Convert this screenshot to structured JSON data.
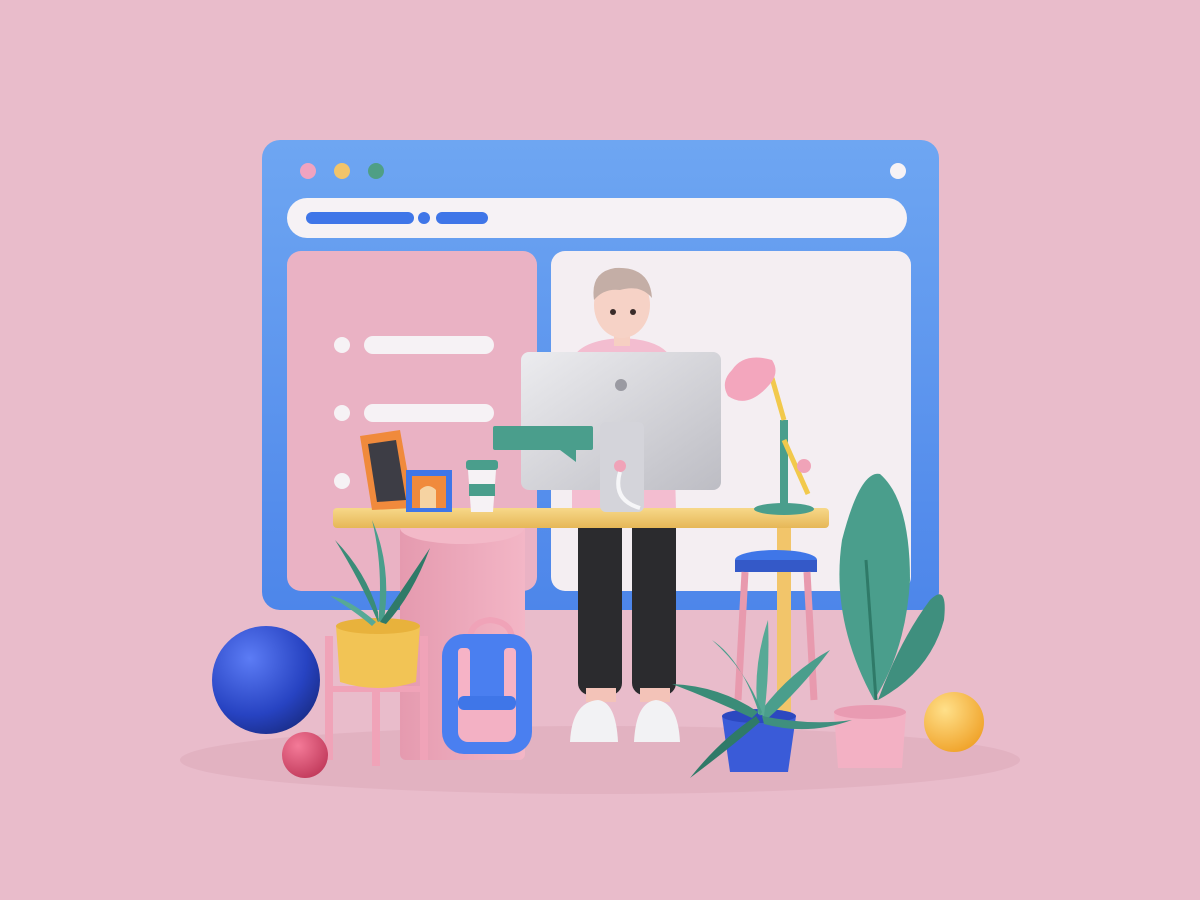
{
  "scene": {
    "description_free": true,
    "colors": {
      "background": "#e9bccb",
      "window_frame": "#5b9df0",
      "window_panel_left": "#eab2c4",
      "window_panel_right": "#f4eef2",
      "url_bar": "#f6f2f5",
      "accent_blue": "#3f76e8",
      "teal": "#4a9e8c",
      "yellow": "#f2c94c",
      "pink": "#f0a3b8",
      "orange": "#f08a3c",
      "monitor": "#d8d8dc"
    },
    "window_controls": [
      {
        "name": "dot-pink",
        "color": "#f0a3c0"
      },
      {
        "name": "dot-yellow",
        "color": "#f2c46a"
      },
      {
        "name": "dot-green",
        "color": "#4f9f86"
      }
    ],
    "icons": [
      "window-dot-icon",
      "url-bar",
      "list-bullet-icon",
      "picture-frame-icon",
      "coffee-cup-icon",
      "chat-bubble-icon",
      "desk-lamp-icon",
      "monitor-icon",
      "backpack-icon",
      "plant-icon",
      "sphere-icon",
      "stool-icon"
    ]
  }
}
